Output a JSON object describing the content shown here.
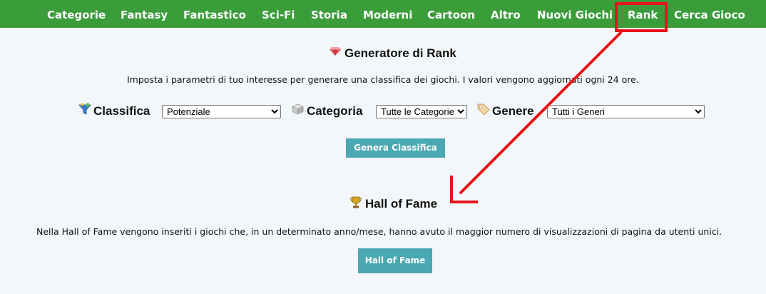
{
  "nav": {
    "items": [
      {
        "id": "categorie",
        "label": "Categorie"
      },
      {
        "id": "fantasy",
        "label": "Fantasy"
      },
      {
        "id": "fantastico",
        "label": "Fantastico"
      },
      {
        "id": "scifi",
        "label": "Sci-Fi"
      },
      {
        "id": "storia",
        "label": "Storia"
      },
      {
        "id": "moderni",
        "label": "Moderni"
      },
      {
        "id": "cartoon",
        "label": "Cartoon"
      },
      {
        "id": "altro",
        "label": "Altro"
      },
      {
        "id": "nuovi",
        "label": "Nuovi Giochi"
      },
      {
        "id": "rank",
        "label": "Rank"
      },
      {
        "id": "cerca",
        "label": "Cerca Gioco"
      }
    ]
  },
  "rank": {
    "title": "Generatore di Rank",
    "description": "Imposta i parametri di tuo interesse per generare una classifica dei giochi. I valori vengono aggiornati ogni 24 ore.",
    "filters": {
      "classifica": {
        "label": "Classifica",
        "selected": "Potenziale",
        "icon": "funnel-icon"
      },
      "categoria": {
        "label": "Categoria",
        "selected": "Tutte le Categorie",
        "icon": "cube-icon"
      },
      "genere": {
        "label": "Genere",
        "selected": "Tutti i Generi",
        "icon": "tag-icon"
      }
    },
    "button_label": "Genera Classifica",
    "title_icon": "gem-icon"
  },
  "hall": {
    "title": "Hall of Fame",
    "description": "Nella Hall of Fame vengono inseriti i giochi che, in un determinato anno/mese, hanno avuto il maggior numero di visualizzazioni di pagina da utenti unici.",
    "button_label": "Hall of Fame",
    "title_icon": "trophy-icon"
  },
  "colors": {
    "nav_bg": "#3a9d3a",
    "button_bg": "#4aa8b3",
    "page_bg": "#f3f7fa",
    "annotation": "#e8141b"
  }
}
